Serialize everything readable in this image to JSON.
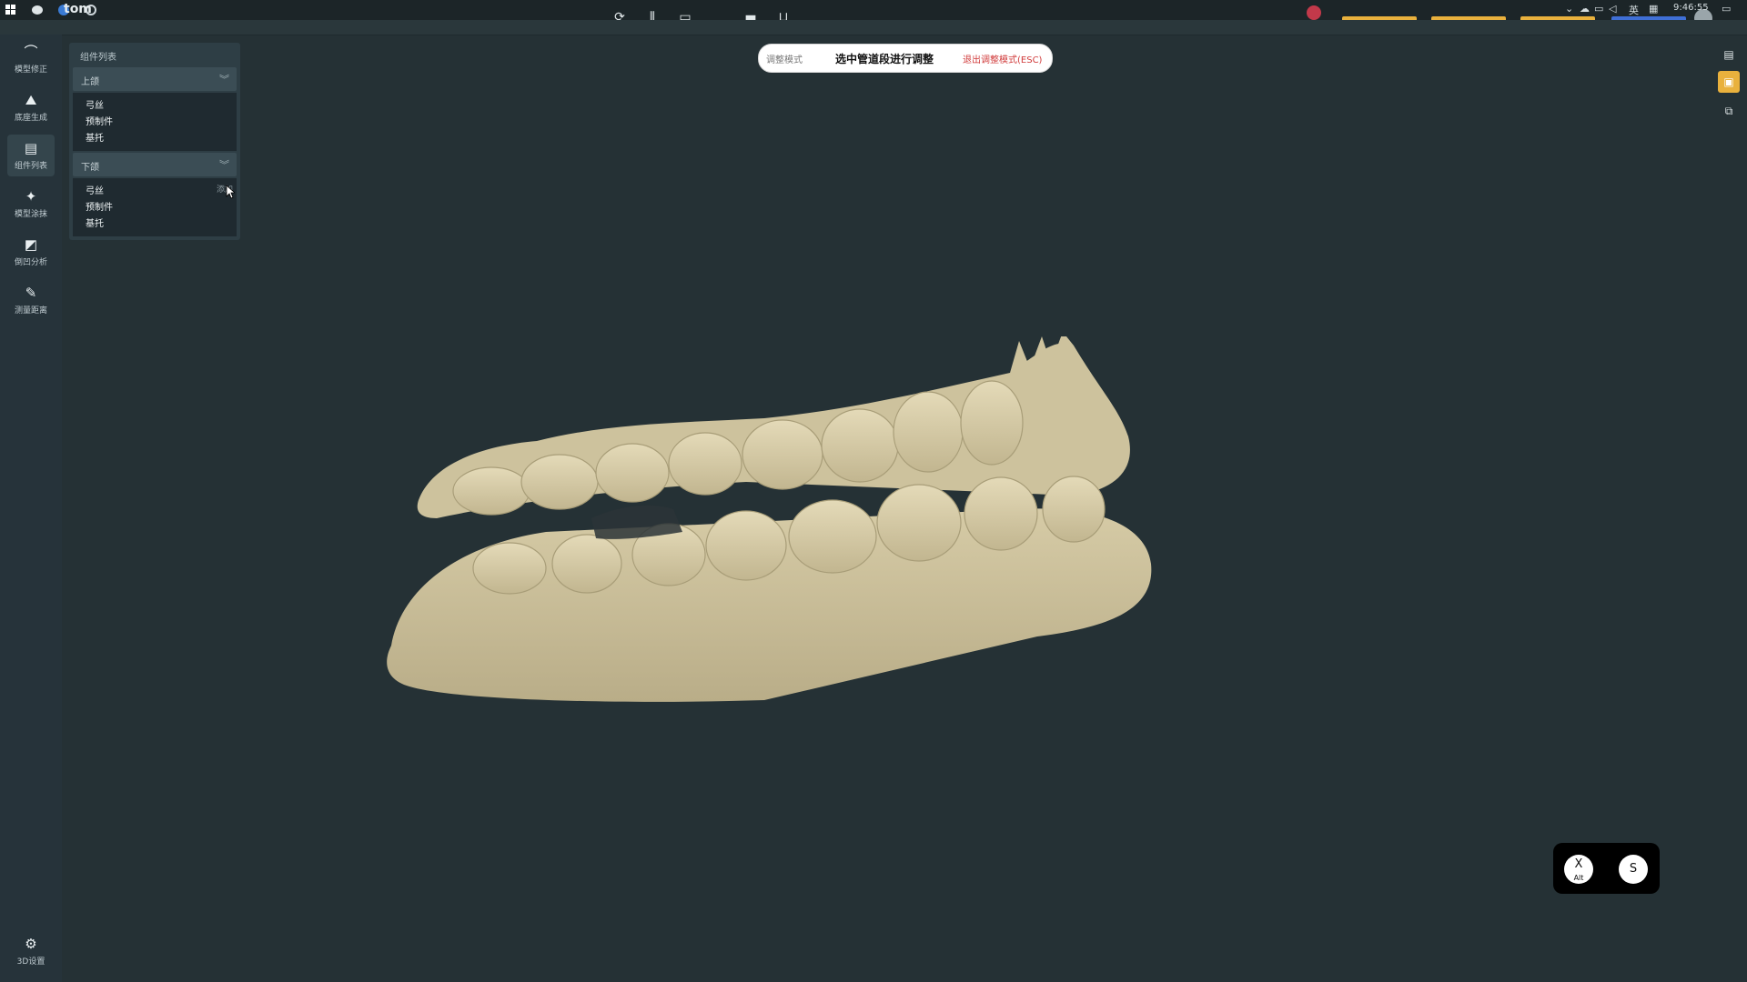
{
  "top_bar": {
    "logo_text": "tom",
    "clock": "9:46:55",
    "ime": "英"
  },
  "left_rail": [
    {
      "icon": "arc-icon",
      "glyph": "⌒",
      "label": "模型修正"
    },
    {
      "icon": "base-generate-icon",
      "glyph": "⛰",
      "label": "底座生成"
    },
    {
      "icon": "component-list-icon",
      "glyph": "▤",
      "label": "组件列表",
      "active": true
    },
    {
      "icon": "model-paint-icon",
      "glyph": "✦",
      "label": "模型涂抹"
    },
    {
      "icon": "undercut-analysis-icon",
      "glyph": "◩",
      "label": "倒凹分析"
    },
    {
      "icon": "measure-distance-icon",
      "glyph": "✎",
      "label": "测量距离"
    }
  ],
  "settings": {
    "label": "3D设置"
  },
  "panel": {
    "title": "组件列表",
    "upper": {
      "label": "上颌",
      "items": [
        "弓丝",
        "预制件",
        "基托"
      ]
    },
    "lower": {
      "label": "下颌",
      "items": [
        "弓丝",
        "预制件",
        "基托"
      ],
      "add_label": "添加"
    }
  },
  "mode_bar": {
    "mode": "调整模式",
    "hint": "选中管道段进行调整",
    "exit": "退出调整模式(ESC)"
  },
  "view_pad": {
    "x_label": "X",
    "x_sub": "Alt",
    "s_label": "S"
  },
  "colors": {
    "background": "#253135",
    "accent": "#e9b13d",
    "model": "#cfc4a0"
  }
}
